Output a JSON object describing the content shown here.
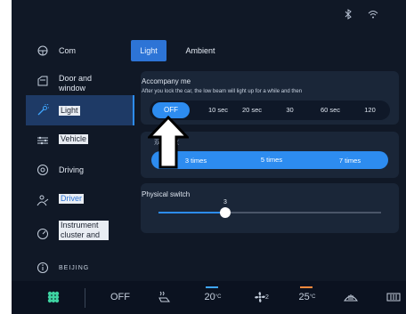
{
  "sidebar": {
    "items": [
      {
        "label": "Com",
        "icon": "steering-wheel-icon",
        "active": false
      },
      {
        "label": "Door and window",
        "icon": "car-door-icon",
        "active": false
      },
      {
        "label": "Light",
        "icon": "light-icon",
        "active": true
      },
      {
        "label": "Vehicle",
        "icon": "vehicle-settings-icon",
        "active": false
      },
      {
        "label": "Driving",
        "icon": "driving-icon",
        "active": false
      },
      {
        "label": "Driver",
        "icon": "driver-icon",
        "active": false
      },
      {
        "label": "Instrument cluster and",
        "icon": "gauge-icon",
        "active": false
      },
      {
        "label": "BEIJING",
        "icon": "info-icon",
        "active": false
      }
    ]
  },
  "tabs": [
    {
      "label": "Light",
      "active": true
    },
    {
      "label": "Ambient",
      "active": false
    }
  ],
  "accompany": {
    "title": "Accompany me",
    "description": "After you lock the car, the low beam will light up for a while and then",
    "options": [
      "OFF",
      "10 sec",
      "20 sec",
      "30",
      "60 sec",
      "120"
    ],
    "selected": "OFF"
  },
  "flash": {
    "title": "双闪次数",
    "options": [
      "3 times",
      "5 times",
      "7 times"
    ],
    "selected": "3 times"
  },
  "physical_switch": {
    "title": "Physical switch",
    "level": 3,
    "level_label": "3"
  },
  "bottombar": {
    "ac_label": "OFF",
    "temp_left": "20",
    "temp_right": "25",
    "fan_level": "2",
    "temp_unit": "°C"
  },
  "colors": {
    "background": "#101826",
    "accent": "#2d8cf0",
    "panel": "#1a2638",
    "temp_left_accent": "#3fa6ff",
    "temp_right_accent": "#ff8a3d"
  }
}
